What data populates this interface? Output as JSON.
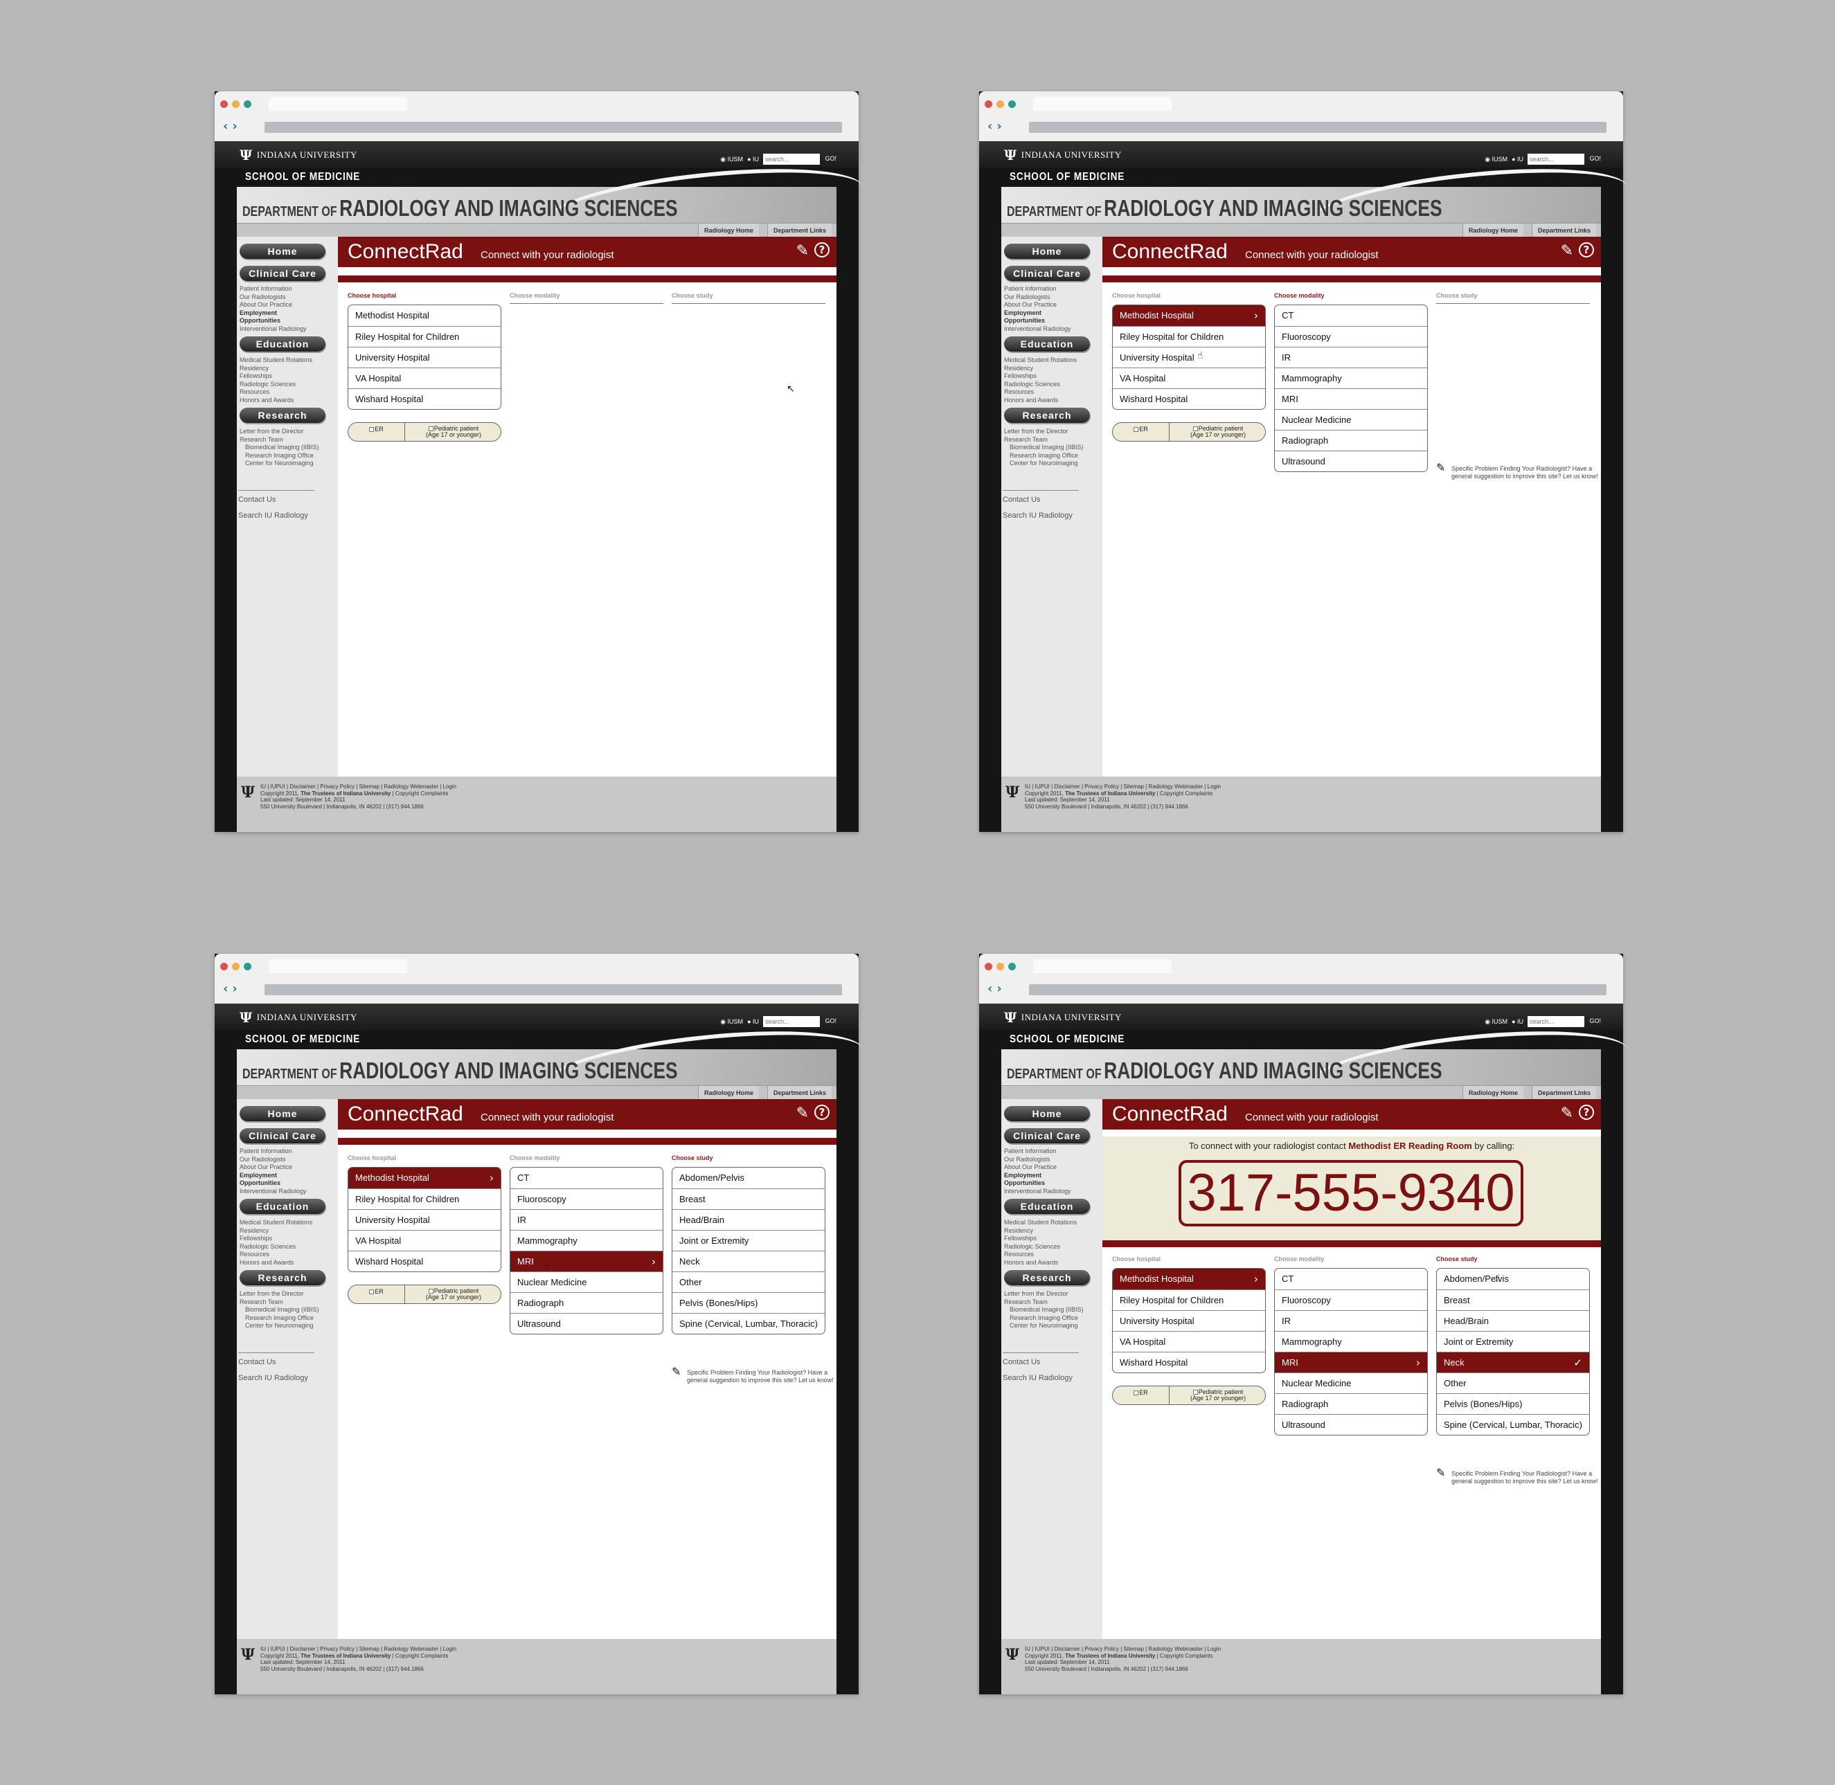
{
  "browser_dots": [
    "#d9534f",
    "#f0ad4e",
    "#2a9d8f"
  ],
  "site": {
    "university": "INDIANA UNIVERSITY",
    "search_options": [
      "IUSM",
      "IU"
    ],
    "search_placeholder": "search...",
    "search_go": "GO!",
    "school": "SCHOOL OF MEDICINE",
    "department_prefix": "DEPARTMENT OF",
    "department_name": "RADIOLOGY AND IMAGING SCIENCES",
    "dept_links": [
      "Radiology Home",
      "Department Links"
    ]
  },
  "sidebar": {
    "home": "Home",
    "clinical_care": "Clinical Care",
    "clinical_items": [
      "Patient Information",
      "Our Radiologists",
      "About Our Practice",
      "Employment",
      "Opportunities",
      "Interventional Radiology"
    ],
    "education": "Education",
    "education_items": [
      "Medical Student Rotations",
      "Residency",
      "Fellowships",
      "Radiologic Sciences",
      "Resources",
      "Honors and Awards"
    ],
    "research": "Research",
    "research_items": [
      "Letter from the Director",
      "Research Team",
      "Biomedical Imaging (IIBIS)",
      "Research Imaging Office",
      "Center for Neuroimaging"
    ],
    "contact": "Contact Us",
    "search": "Search IU Radiology"
  },
  "connectrad": {
    "brand": "ConnectRad",
    "tagline": "Connect with your radiologist",
    "labels": {
      "hospital": "Choose hospital",
      "modality": "Choose modality",
      "study": "Choose study"
    },
    "hospitals": [
      "Methodist Hospital",
      "Riley Hospital for Children",
      "University Hospital",
      "VA Hospital",
      "Wishard Hospital"
    ],
    "modalities": [
      "CT",
      "Fluoroscopy",
      "IR",
      "Mammography",
      "MRI",
      "Nuclear Medicine",
      "Radiograph",
      "Ultrasound"
    ],
    "studies": [
      "Abdomen/Pelvis",
      "Breast",
      "Head/Brain",
      "Joint or Extremity",
      "Neck",
      "Other",
      "Pelvis (Bones/Hips)",
      "Spine (Cervical, Lumbar, Thoracic)"
    ],
    "er_label": "ER",
    "ped_label": "Pediatric patient",
    "ped_sub": "(Age 17 or younger)",
    "suggestion": "Specific Problem Finding Your Radiologist? Have a general suggestion to improve this site? Let us know!",
    "call_prefix": "To connect with your radiologist contact",
    "call_location": "Methodist ER Reading Room",
    "call_suffix": "by calling:",
    "phone": "317-555-9340"
  },
  "footer": {
    "links": "IU | IUPUI | Disclaimer | Privacy Policy | Sitemap | Radiology Webmaster | Login",
    "copyright_prefix": "Copyright 2011,",
    "copyright_owner": "The Trustees of Indiana University",
    "copyright_suffix": "| Copyright Complaints",
    "updated": "Last updated: September 14, 2011",
    "address": "550 University Boulevard | Indianapolis, IN 46202 | (317) 944.1866"
  }
}
